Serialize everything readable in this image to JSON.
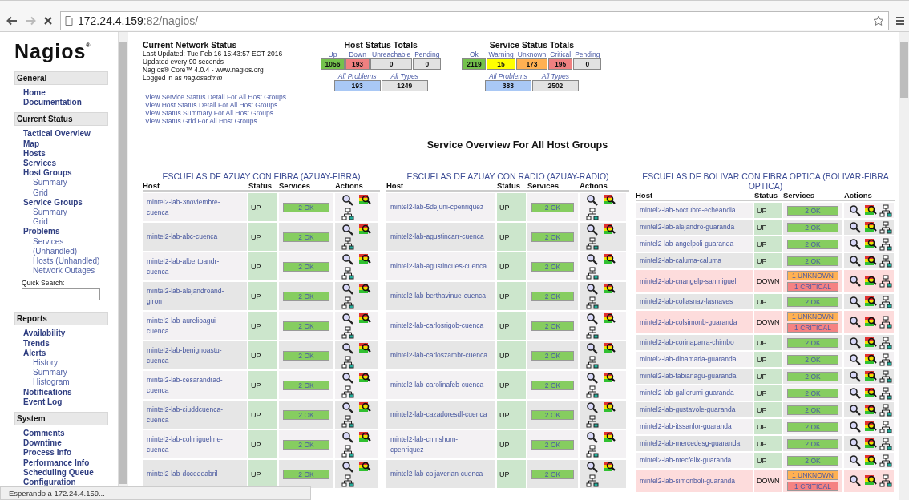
{
  "browser": {
    "url_host": "172.24.4.159",
    "url_path": ":82/nagios/"
  },
  "sidebar": {
    "logo": "Nagios",
    "logo_mark": "®",
    "sections": [
      {
        "title": "General",
        "items": [
          {
            "label": "Home"
          },
          {
            "label": "Documentation"
          }
        ]
      },
      {
        "title": "Current Status",
        "items": [
          {
            "label": "Tactical Overview"
          },
          {
            "label": "Map"
          },
          {
            "label": "Hosts"
          },
          {
            "label": "Services"
          },
          {
            "label": "Host Groups",
            "children": [
              {
                "label": "Summary"
              },
              {
                "label": "Grid"
              }
            ]
          },
          {
            "label": "Service Groups",
            "children": [
              {
                "label": "Summary"
              },
              {
                "label": "Grid"
              }
            ]
          },
          {
            "label": "Problems",
            "children": [
              {
                "label": "Services"
              },
              {
                "label": "(Unhandled)"
              },
              {
                "label": "Hosts (Unhandled)"
              },
              {
                "label": "Network Outages"
              }
            ]
          }
        ],
        "search_label": "Quick Search:"
      },
      {
        "title": "Reports",
        "items": [
          {
            "label": "Availability"
          },
          {
            "label": "Trends"
          },
          {
            "label": "Alerts",
            "children": [
              {
                "label": "History"
              },
              {
                "label": "Summary"
              },
              {
                "label": "Histogram"
              }
            ]
          },
          {
            "label": "Notifications"
          },
          {
            "label": "Event Log"
          }
        ]
      },
      {
        "title": "System",
        "items": [
          {
            "label": "Comments"
          },
          {
            "label": "Downtime"
          },
          {
            "label": "Process Info"
          },
          {
            "label": "Performance Info"
          },
          {
            "label": "Scheduling Queue"
          },
          {
            "label": "Configuration"
          }
        ]
      }
    ]
  },
  "network_status": {
    "title": "Current Network Status",
    "lines": [
      "Last Updated: Tue Feb 16 15:43:57 ECT 2016",
      "Updated every 90 seconds",
      "Nagios® Core™ 4.0.4 - www.nagios.org",
      "Logged in as *nagiosadmin*"
    ],
    "links": [
      "View Service Status Detail For All Host Groups",
      "View Host Status Detail For All Host Groups",
      "View Status Summary For All Host Groups",
      "View Status Grid For All Host Groups"
    ]
  },
  "totals": [
    {
      "title": "Host Status Totals",
      "cells": [
        {
          "label": "Up",
          "value": "1056",
          "color": "#74c24c"
        },
        {
          "label": "Down",
          "value": "193",
          "color": "#f08080"
        },
        {
          "label": "Unreachable",
          "value": "0",
          "color": "#e2e2e2"
        },
        {
          "label": "Pending",
          "value": "0",
          "color": "#e2e2e2"
        }
      ],
      "summary": [
        {
          "label": "All Problems",
          "value": "193",
          "color": "#a9c8f5"
        },
        {
          "label": "All Types",
          "value": "1249",
          "color": "#e2e2e2"
        }
      ]
    },
    {
      "title": "Service Status Totals",
      "cells": [
        {
          "label": "Ok",
          "value": "2119",
          "color": "#74c24c"
        },
        {
          "label": "Warning",
          "value": "15",
          "color": "#ffff00"
        },
        {
          "label": "Unknown",
          "value": "173",
          "color": "#ffb152"
        },
        {
          "label": "Critical",
          "value": "195",
          "color": "#f08080"
        },
        {
          "label": "Pending",
          "value": "0",
          "color": "#e2e2e2"
        }
      ],
      "summary": [
        {
          "label": "All Problems",
          "value": "383",
          "color": "#a9c8f5"
        },
        {
          "label": "All Types",
          "value": "2502",
          "color": "#e2e2e2"
        }
      ]
    }
  ],
  "overview_title": "Service Overview For All Host Groups",
  "groups": [
    {
      "title": "ESCUELAS DE AZUAY CON FIBRA (AZUAY-FIBRA)",
      "columns": [
        "Host",
        "Status",
        "Services",
        "Actions"
      ],
      "hosts": [
        {
          "name": "mintel2-lab-3noviembre-cuenca",
          "status": "UP",
          "down": false,
          "services": [
            {
              "label": "2 OK",
              "kind": "ok"
            }
          ]
        },
        {
          "name": "mintel2-lab-abc-cuenca",
          "status": "UP",
          "down": false,
          "services": [
            {
              "label": "2 OK",
              "kind": "ok"
            }
          ]
        },
        {
          "name": "mintel2-lab-albertoandr-cuenca",
          "status": "UP",
          "down": false,
          "services": [
            {
              "label": "2 OK",
              "kind": "ok"
            }
          ]
        },
        {
          "name": "mintel2-lab-alejandroand-giron",
          "status": "UP",
          "down": false,
          "services": [
            {
              "label": "2 OK",
              "kind": "ok"
            }
          ]
        },
        {
          "name": "mintel2-lab-aurelioagui-cuenca",
          "status": "UP",
          "down": false,
          "services": [
            {
              "label": "2 OK",
              "kind": "ok"
            }
          ]
        },
        {
          "name": "mintel2-lab-benignoastu-cuenca",
          "status": "UP",
          "down": false,
          "services": [
            {
              "label": "2 OK",
              "kind": "ok"
            }
          ]
        },
        {
          "name": "mintel2-lab-cesarandrad-cuenca",
          "status": "UP",
          "down": false,
          "services": [
            {
              "label": "2 OK",
              "kind": "ok"
            }
          ]
        },
        {
          "name": "mintel2-lab-ciuddcuenca-cuenca",
          "status": "UP",
          "down": false,
          "services": [
            {
              "label": "2 OK",
              "kind": "ok"
            }
          ]
        },
        {
          "name": "mintel2-lab-colmiguelme-cuenca",
          "status": "UP",
          "down": false,
          "services": [
            {
              "label": "2 OK",
              "kind": "ok"
            }
          ]
        },
        {
          "name": "mintel2-lab-docedeabril-",
          "status": "UP",
          "down": false,
          "services": [
            {
              "label": "2 OK",
              "kind": "ok"
            }
          ]
        }
      ]
    },
    {
      "title": "ESCUELAS DE AZUAY CON RADIO (AZUAY-RADIO)",
      "columns": [
        "Host",
        "Status",
        "Services",
        "Actions"
      ],
      "hosts": [
        {
          "name": "mintel2-lab-5dejuni-cpenriquez",
          "status": "UP",
          "down": false,
          "services": [
            {
              "label": "2 OK",
              "kind": "ok"
            }
          ]
        },
        {
          "name": "mintel2-lab-agustincarr-cuenca",
          "status": "UP",
          "down": false,
          "services": [
            {
              "label": "2 OK",
              "kind": "ok"
            }
          ]
        },
        {
          "name": "mintel2-lab-agustincues-cuenca",
          "status": "UP",
          "down": false,
          "services": [
            {
              "label": "2 OK",
              "kind": "ok"
            }
          ]
        },
        {
          "name": "mintel2-lab-berthavinue-cuenca",
          "status": "UP",
          "down": false,
          "services": [
            {
              "label": "2 OK",
              "kind": "ok"
            }
          ]
        },
        {
          "name": "mintel2-lab-carlosrigob-cuenca",
          "status": "UP",
          "down": false,
          "services": [
            {
              "label": "2 OK",
              "kind": "ok"
            }
          ]
        },
        {
          "name": "mintel2-lab-carloszambr-cuenca",
          "status": "UP",
          "down": false,
          "services": [
            {
              "label": "2 OK",
              "kind": "ok"
            }
          ]
        },
        {
          "name": "mintel2-lab-carolinafeb-cuenca",
          "status": "UP",
          "down": false,
          "services": [
            {
              "label": "2 OK",
              "kind": "ok"
            }
          ]
        },
        {
          "name": "mintel2-lab-cazadoresdl-cuenca",
          "status": "UP",
          "down": false,
          "services": [
            {
              "label": "2 OK",
              "kind": "ok"
            }
          ]
        },
        {
          "name": "mintel2-lab-cnmshum-cpenriquez",
          "status": "UP",
          "down": false,
          "services": [
            {
              "label": "2 OK",
              "kind": "ok"
            }
          ]
        },
        {
          "name": "mintel2-lab-coljaverian-cuenca",
          "status": "UP",
          "down": false,
          "services": [
            {
              "label": "2 OK",
              "kind": "ok"
            }
          ]
        }
      ]
    },
    {
      "title": "ESCUELAS DE BOLIVAR CON FIBRA OPTICA (BOLIVAR-FIBRA OPTICA)",
      "columns": [
        "Host",
        "Status",
        "Services",
        "Actions"
      ],
      "hosts": [
        {
          "name": "mintel2-lab-5octubre-echeandia",
          "status": "UP",
          "down": false,
          "services": [
            {
              "label": "2 OK",
              "kind": "ok"
            }
          ]
        },
        {
          "name": "mintel2-lab-alejandro-guaranda",
          "status": "UP",
          "down": false,
          "services": [
            {
              "label": "2 OK",
              "kind": "ok"
            }
          ]
        },
        {
          "name": "mintel2-lab-angelpoli-guaranda",
          "status": "UP",
          "down": false,
          "services": [
            {
              "label": "2 OK",
              "kind": "ok"
            }
          ]
        },
        {
          "name": "mintel2-lab-caluma-caluma",
          "status": "UP",
          "down": false,
          "services": [
            {
              "label": "2 OK",
              "kind": "ok"
            }
          ]
        },
        {
          "name": "mintel2-lab-cnangelp-sanmiguel",
          "status": "DOWN",
          "down": true,
          "services": [
            {
              "label": "1 UNKNOWN",
              "kind": "unknown"
            },
            {
              "label": "1 CRITICAL",
              "kind": "critical"
            }
          ]
        },
        {
          "name": "mintel2-lab-collasnav-lasnaves",
          "status": "UP",
          "down": false,
          "services": [
            {
              "label": "2 OK",
              "kind": "ok"
            }
          ]
        },
        {
          "name": "mintel2-lab-colsimonb-guaranda",
          "status": "DOWN",
          "down": true,
          "services": [
            {
              "label": "1 UNKNOWN",
              "kind": "unknown"
            },
            {
              "label": "1 CRITICAL",
              "kind": "critical"
            }
          ]
        },
        {
          "name": "mintel2-lab-corinaparra-chimbo",
          "status": "UP",
          "down": false,
          "services": [
            {
              "label": "2 OK",
              "kind": "ok"
            }
          ]
        },
        {
          "name": "mintel2-lab-dinamaria-guaranda",
          "status": "UP",
          "down": false,
          "services": [
            {
              "label": "2 OK",
              "kind": "ok"
            }
          ]
        },
        {
          "name": "mintel2-lab-fabianagu-guaranda",
          "status": "UP",
          "down": false,
          "services": [
            {
              "label": "2 OK",
              "kind": "ok"
            }
          ]
        },
        {
          "name": "mintel2-lab-gallorumi-guaranda",
          "status": "UP",
          "down": false,
          "services": [
            {
              "label": "2 OK",
              "kind": "ok"
            }
          ]
        },
        {
          "name": "mintel2-lab-gustavole-guaranda",
          "status": "UP",
          "down": false,
          "services": [
            {
              "label": "2 OK",
              "kind": "ok"
            }
          ]
        },
        {
          "name": "mintel2-lab-itssanlor-guaranda",
          "status": "UP",
          "down": false,
          "services": [
            {
              "label": "2 OK",
              "kind": "ok"
            }
          ]
        },
        {
          "name": "mintel2-lab-mercedesg-guaranda",
          "status": "UP",
          "down": false,
          "services": [
            {
              "label": "2 OK",
              "kind": "ok"
            }
          ]
        },
        {
          "name": "mintel2-lab-ntecfelix-guaranda",
          "status": "UP",
          "down": false,
          "services": [
            {
              "label": "2 OK",
              "kind": "ok"
            }
          ]
        },
        {
          "name": "mintel2-lab-simonboli-guaranda",
          "status": "DOWN",
          "down": true,
          "services": [
            {
              "label": "1 UNKNOWN",
              "kind": "unknown"
            },
            {
              "label": "1 CRITICAL",
              "kind": "critical"
            }
          ]
        }
      ]
    }
  ],
  "status_bar": "Esperando a 172.24.4.159..."
}
